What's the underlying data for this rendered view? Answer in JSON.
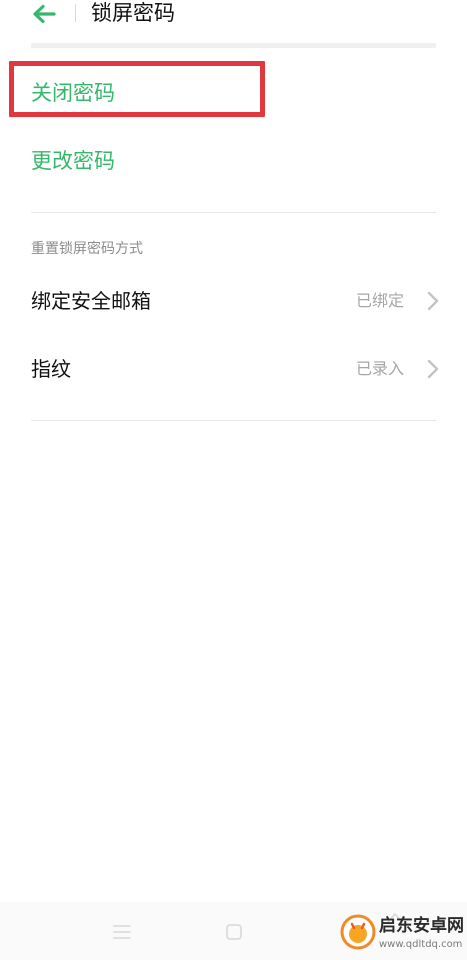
{
  "header": {
    "title": "锁屏密码",
    "back_icon": "arrow-left-icon",
    "accent_color": "#35b86b"
  },
  "actions": {
    "disable_password": "关闭密码",
    "change_password": "更改密码",
    "highlight_color": "#e0383e"
  },
  "reset_section": {
    "label": "重置锁屏密码方式",
    "items": [
      {
        "label": "绑定安全邮箱",
        "value": "已绑定",
        "icon": "chevron-right-icon"
      },
      {
        "label": "指纹",
        "value": "已录入",
        "icon": "chevron-right-icon"
      }
    ]
  },
  "nav_bar": {
    "buttons": [
      "menu-icon",
      "home-icon",
      "back-icon"
    ]
  },
  "watermark": {
    "line1": "启东安卓网",
    "line2": "www.qdltdq.com"
  }
}
